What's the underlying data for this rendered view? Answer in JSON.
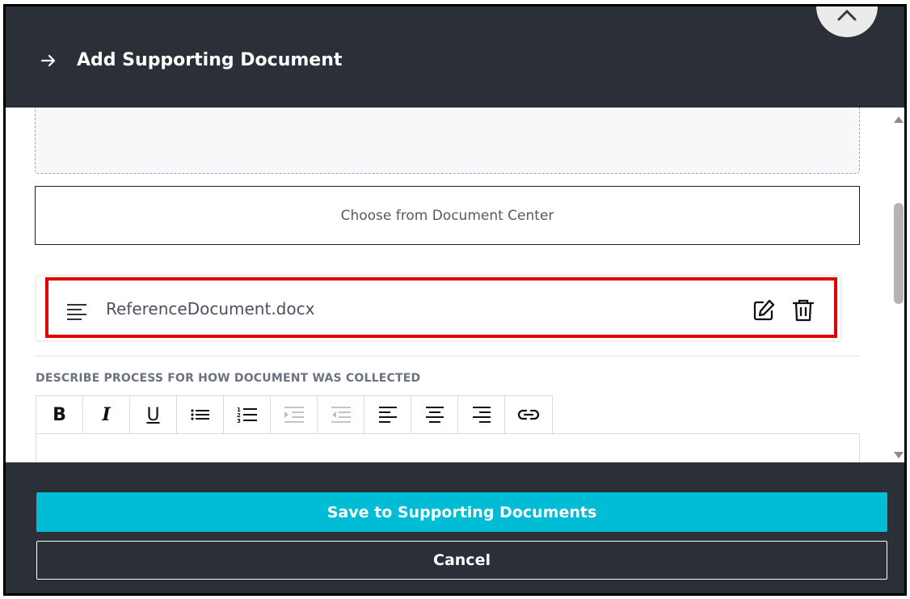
{
  "header": {
    "title": "Add Supporting Document",
    "back_icon": "arrow-right-icon",
    "close_icon": "close-icon"
  },
  "main": {
    "choose_button_label": "Choose from Document Center",
    "attached_document": {
      "file_name": "ReferenceDocument.docx",
      "icon": "text-lines-icon",
      "actions": [
        "edit-icon",
        "trash-icon"
      ]
    },
    "description_label": "DESCRIBE PROCESS FOR HOW DOCUMENT WAS COLLECTED",
    "toolbar": {
      "bold": "B",
      "italic": "I",
      "underline": "U",
      "icons": [
        "bullet-list-icon",
        "numbered-list-icon",
        "indent-icon",
        "outdent-icon",
        "align-left-icon",
        "align-center-icon",
        "align-right-icon",
        "link-icon"
      ]
    }
  },
  "footer": {
    "save_label": "Save to Supporting Documents",
    "cancel_label": "Cancel"
  },
  "colors": {
    "header_bg": "#2a2f38",
    "accent": "#00bcd4",
    "highlight": "#e00000"
  }
}
